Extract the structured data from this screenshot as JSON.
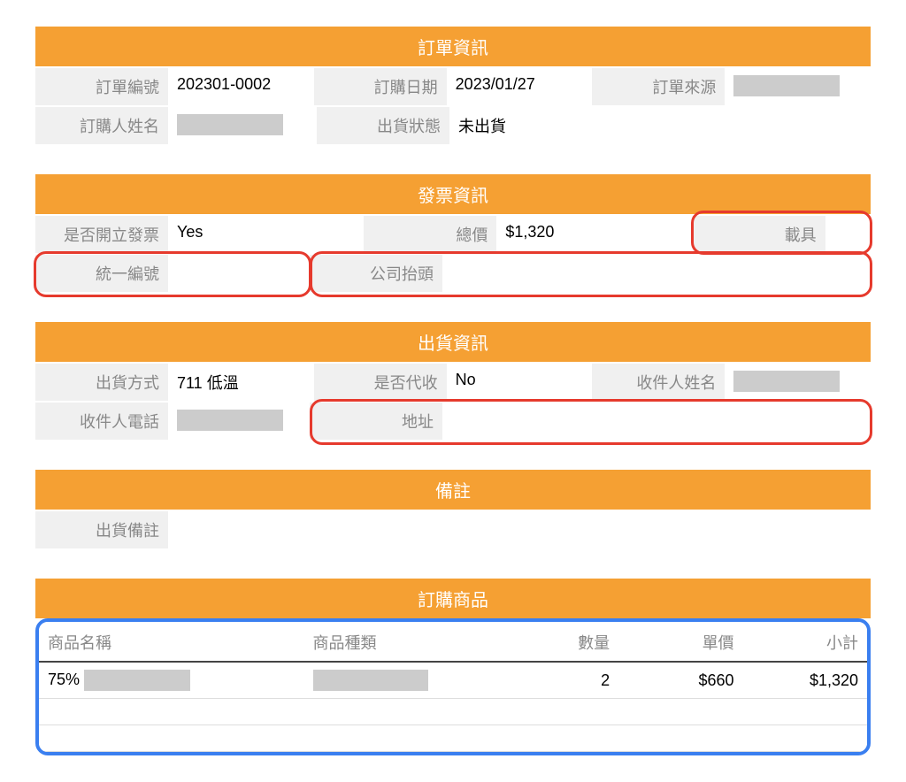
{
  "order_info": {
    "header": "訂單資訊",
    "labels": {
      "order_no": "訂單編號",
      "order_date": "訂購日期",
      "order_source": "訂單來源",
      "buyer_name": "訂購人姓名",
      "ship_status": "出貨狀態"
    },
    "values": {
      "order_no": "202301-0002",
      "order_date": "2023/01/27",
      "order_source": "",
      "buyer_name": "",
      "ship_status": "未出貨"
    }
  },
  "invoice_info": {
    "header": "發票資訊",
    "labels": {
      "issue": "是否開立發票",
      "total": "總價",
      "carrier": "載具",
      "vat": "統一編號",
      "company": "公司抬頭"
    },
    "values": {
      "issue": "Yes",
      "total": "$1,320",
      "carrier": "",
      "vat": "",
      "company": ""
    }
  },
  "ship_info": {
    "header": "出貨資訊",
    "labels": {
      "method": "出貨方式",
      "cod": "是否代收",
      "recipient": "收件人姓名",
      "phone": "收件人電話",
      "address": "地址"
    },
    "values": {
      "method": "711 低溫",
      "cod": "No",
      "recipient": "",
      "phone": "",
      "address": ""
    }
  },
  "remark": {
    "header": "備註",
    "labels": {
      "ship_remark": "出貨備註"
    },
    "values": {
      "ship_remark": ""
    }
  },
  "products": {
    "header": "訂購商品",
    "columns": {
      "name": "商品名稱",
      "kind": "商品種類",
      "qty": "數量",
      "price": "單價",
      "sub": "小計"
    },
    "rows": [
      {
        "name_prefix": "75%",
        "name_rest": "",
        "kind": "",
        "qty": "2",
        "price": "$660",
        "sub": "$1,320"
      }
    ]
  }
}
